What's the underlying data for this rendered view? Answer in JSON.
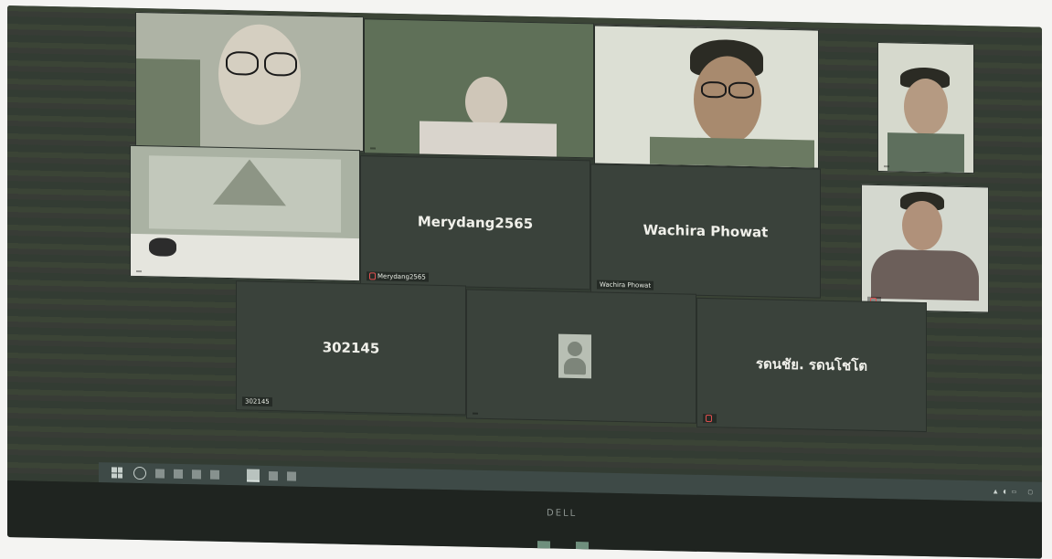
{
  "window": {
    "app": "video-conference"
  },
  "participants": [
    {
      "id": "p1",
      "name": "",
      "video": true
    },
    {
      "id": "p2",
      "name": "",
      "video": true
    },
    {
      "id": "p3",
      "name": "",
      "video": true
    },
    {
      "id": "p4",
      "name": "",
      "video": true
    },
    {
      "id": "p5",
      "name": "",
      "video": true
    },
    {
      "id": "p6",
      "name": "Merydang2565",
      "tag": "Merydang2565",
      "video": false
    },
    {
      "id": "p7",
      "name": "Wachira Phowat",
      "tag": "Wachira Phowat",
      "video": false
    },
    {
      "id": "p8",
      "name": "",
      "video": true
    },
    {
      "id": "p9",
      "name": "302145",
      "tag": "302145",
      "video": false
    },
    {
      "id": "p10",
      "name": "",
      "tag": "",
      "video": false,
      "avatar": true
    },
    {
      "id": "p11",
      "name": "รดนชัย. รดนโชโต",
      "tag": "",
      "video": false
    }
  ],
  "taskbar": {
    "icons": [
      "start-icon",
      "search-icon",
      "task-view-icon",
      "edge-icon",
      "explorer-icon",
      "store-icon",
      "mail-icon",
      "zoom-icon",
      "chrome-icon",
      "word-icon"
    ],
    "tray_text": ""
  },
  "monitor": {
    "brand": "DELL"
  },
  "colors": {
    "screen_bg": "#343c34",
    "taskbar_bg": "#3e4a47",
    "mute_red": "#e05050"
  }
}
